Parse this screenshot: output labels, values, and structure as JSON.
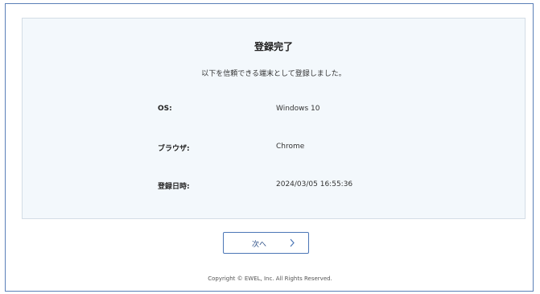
{
  "card": {
    "title": "登録完了",
    "message": "以下を信頼できる端末として登録しました。",
    "rows": [
      {
        "label": "OS:",
        "value": "Windows 10"
      },
      {
        "label": "ブラウザ:",
        "value": "Chrome"
      },
      {
        "label": "登録日時:",
        "value": "2024/03/05 16:55:36"
      }
    ]
  },
  "next_button": {
    "label": "次へ",
    "icon": "chevron-right-icon"
  },
  "footer": {
    "copyright": "Copyright © EWEL, Inc. All Rights Reserved."
  },
  "colors": {
    "frame_border": "#5a7fb8",
    "card_background": "#f3f8fc",
    "button_border": "#4b76b6"
  }
}
